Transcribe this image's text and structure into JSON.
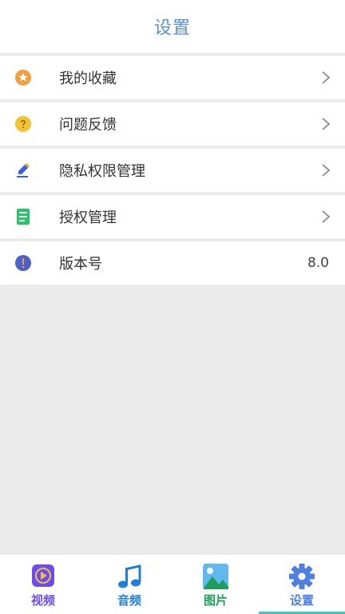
{
  "header": {
    "title": "设置"
  },
  "menu": {
    "items": [
      {
        "label": "我的收藏",
        "icon": "star-icon",
        "color": "#f0a040",
        "chevron": true
      },
      {
        "label": "问题反馈",
        "icon": "question-icon",
        "color": "#f4c430",
        "chevron": true
      },
      {
        "label": "隐私权限管理",
        "icon": "pencil-icon",
        "color": "#3d5fe0",
        "chevron": true
      },
      {
        "label": "授权管理",
        "icon": "document-icon",
        "color": "#27c46a",
        "chevron": true
      },
      {
        "label": "版本号",
        "icon": "info-icon",
        "color": "#4f5fc8",
        "value": "8.0"
      }
    ]
  },
  "tabs": [
    {
      "label": "视频",
      "icon": "video-play-icon",
      "color": "#6a4cf0",
      "active": false
    },
    {
      "label": "音频",
      "icon": "music-note-icon",
      "color": "#1f7fd6",
      "active": false
    },
    {
      "label": "图片",
      "icon": "image-icon",
      "color": "#1f9e5a",
      "active": false
    },
    {
      "label": "设置",
      "icon": "gear-icon",
      "color": "#4f7fe0",
      "active": true
    }
  ]
}
